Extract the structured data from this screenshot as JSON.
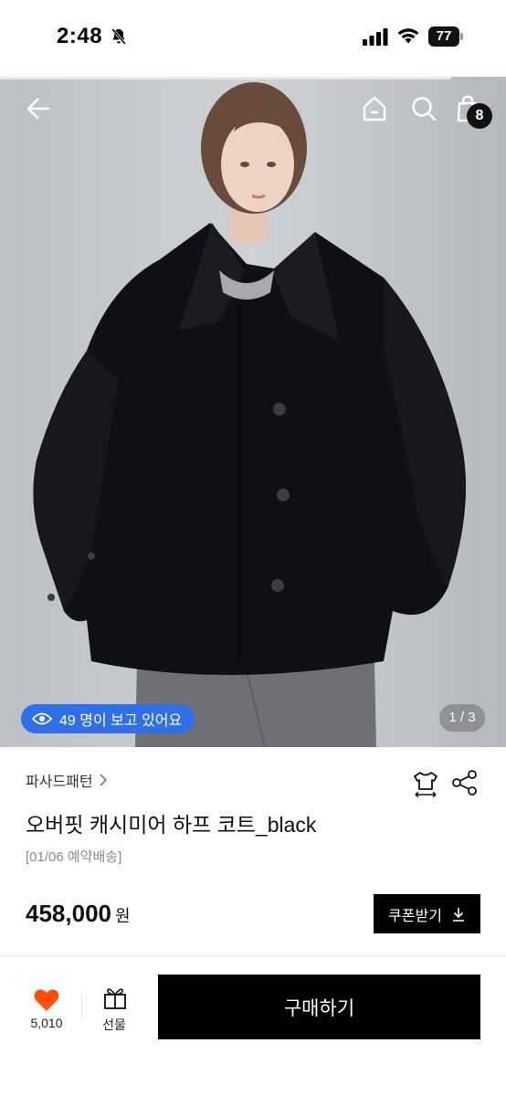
{
  "status_bar": {
    "time": "2:48",
    "battery": "77",
    "icons": [
      "bell-slash-icon",
      "cellular-signal-icon",
      "wifi-icon",
      "battery-icon"
    ]
  },
  "header": {
    "icons": [
      "back-arrow-icon",
      "home-icon",
      "search-icon",
      "shopping-bag-icon"
    ],
    "cart_count": "8"
  },
  "gallery": {
    "viewers_text": "49 명이 보고 있어요",
    "page_indicator": "1 / 3",
    "image_description_icon": "eye-icon"
  },
  "product": {
    "brand": "파사드패턴",
    "title": "오버핏 캐시미어 하프 코트_black",
    "delivery_note": "[01/06 예약배송]",
    "price": "458,000",
    "currency": "원",
    "coupon_label": "쿠폰받기",
    "icons": [
      "chevron-right-icon",
      "size-guide-icon",
      "share-icon",
      "download-icon"
    ]
  },
  "bottom_bar": {
    "like_count": "5,010",
    "gift_label": "선물",
    "buy_label": "구매하기",
    "icons": [
      "heart-icon",
      "gift-icon"
    ]
  },
  "colors": {
    "accent_blue": "#2f6fe8",
    "heart_orange": "#ff4d0a",
    "button_black": "#000000"
  }
}
